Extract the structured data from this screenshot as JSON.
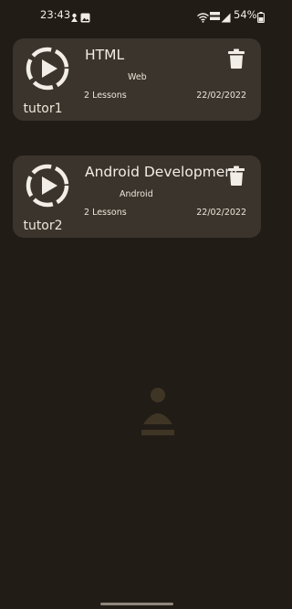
{
  "status_bar": {
    "time": "23:43",
    "battery": "54%",
    "icons": [
      "notification-icon",
      "gallery-icon",
      "wifi-icon",
      "volte-icon",
      "signal-icon",
      "battery-icon"
    ]
  },
  "tutorials": [
    {
      "thumbnail_icon": "play-circle-icon",
      "tutor": "tutor1",
      "title": "HTML",
      "category": "Web",
      "lessons": "2 Lessons",
      "date": "22/02/2022",
      "action_icon": "trash-icon"
    },
    {
      "thumbnail_icon": "play-circle-icon",
      "tutor": "tutor2",
      "title": "Android Development",
      "category": "Android",
      "lessons": "2 Lessons",
      "date": "22/02/2022",
      "action_icon": "trash-icon"
    }
  ],
  "colors": {
    "background": "#211c16",
    "card": "#3a342c",
    "text": "#ece6dc",
    "accent_icon": "#f2ede6"
  }
}
